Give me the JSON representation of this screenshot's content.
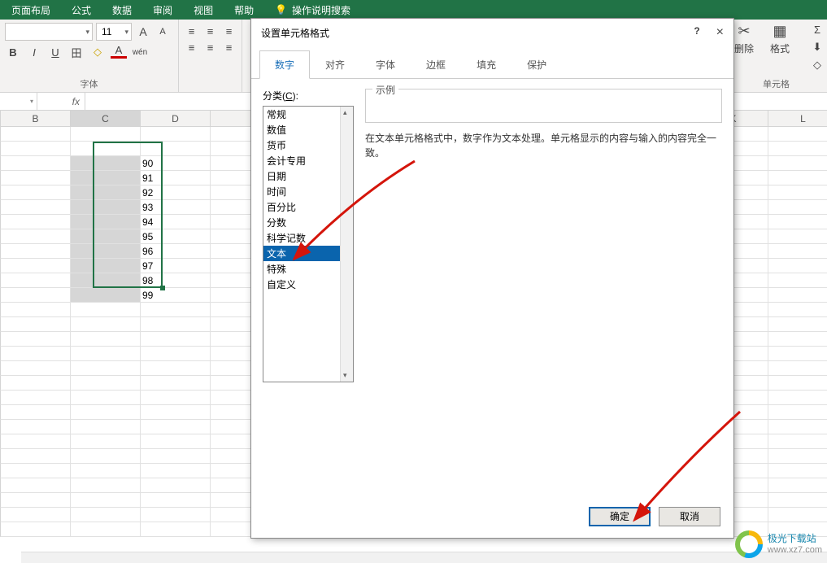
{
  "ribbon": {
    "tabs": [
      "页面布局",
      "公式",
      "数据",
      "审阅",
      "视图",
      "帮助"
    ],
    "tell_me": "操作说明搜索",
    "font_size": "11",
    "group_font_label": "字体",
    "btn_bold": "B",
    "btn_italic": "I",
    "btn_underline": "U",
    "btn_border": "田",
    "btn_fill": "◇",
    "btn_fontcolor": "A",
    "btn_ruby": "wén",
    "btn_bigA": "A",
    "btn_smallA": "A",
    "cells_delete": "删除",
    "cells_format": "格式",
    "group_cells_label": "单元格",
    "sigma": "Σ",
    "fill_down": "⬇",
    "clear": "◇"
  },
  "formula": {
    "fx": "fx"
  },
  "columns": [
    "B",
    "C",
    "D",
    "K",
    "L"
  ],
  "cell_values": [
    "90",
    "91",
    "92",
    "93",
    "94",
    "95",
    "96",
    "97",
    "98",
    "99"
  ],
  "dialog": {
    "title": "设置单元格格式",
    "help": "?",
    "close": "×",
    "tabs": [
      "数字",
      "对齐",
      "字体",
      "边框",
      "填充",
      "保护"
    ],
    "category_label_pre": "分类(",
    "category_label_u": "C",
    "category_label_post": "):",
    "categories": [
      "常规",
      "数值",
      "货币",
      "会计专用",
      "日期",
      "时间",
      "百分比",
      "分数",
      "科学记数",
      "文本",
      "特殊",
      "自定义"
    ],
    "selected_category_index": 9,
    "example_label": "示例",
    "description": "在文本单元格格式中，数字作为文本处理。单元格显示的内容与输入的内容完全一致。",
    "ok": "确定",
    "cancel": "取消"
  },
  "watermark": {
    "name": "极光下载站",
    "url": "www.xz7.com"
  }
}
